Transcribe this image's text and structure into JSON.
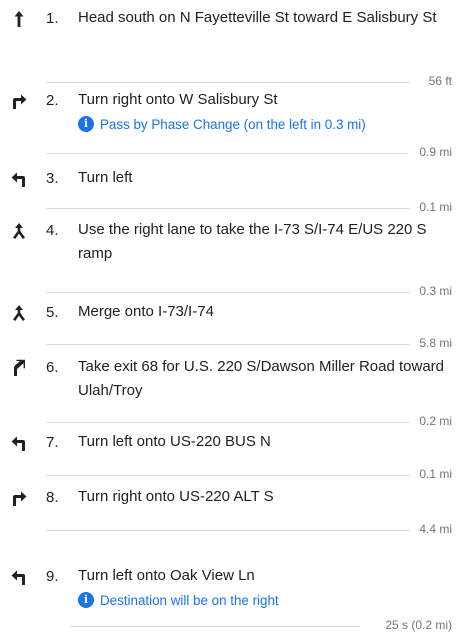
{
  "steps": [
    {
      "num": "1.",
      "icon": "straight-arrow-icon",
      "text": "Head south on N Fayetteville St toward E Salisbury St",
      "note": "",
      "distance": "56 ft"
    },
    {
      "num": "2.",
      "icon": "turn-right-icon",
      "text": "Turn right onto W Salisbury St",
      "note": "Pass by Phase Change (on the left in 0.3 mi)",
      "distance": "0.9 mi"
    },
    {
      "num": "3.",
      "icon": "turn-left-icon",
      "text": "Turn left",
      "note": "",
      "distance": "0.1 mi"
    },
    {
      "num": "4.",
      "icon": "merge-icon",
      "text": "Use the right lane to take the I-73 S/I-74 E/US 220 S ramp",
      "note": "",
      "distance": "0.3 mi"
    },
    {
      "num": "5.",
      "icon": "merge-icon",
      "text": "Merge onto I-73/I-74",
      "note": "",
      "distance": "5.8 mi"
    },
    {
      "num": "6.",
      "icon": "slight-right-icon",
      "text": "Take exit 68 for U.S. 220 S/Dawson Miller Road toward Ulah/Troy",
      "note": "",
      "distance": "0.2 mi"
    },
    {
      "num": "7.",
      "icon": "turn-left-icon",
      "text": "Turn left onto US-220 BUS N",
      "note": "",
      "distance": "0.1 mi"
    },
    {
      "num": "8.",
      "icon": "turn-right-icon",
      "text": "Turn right onto US-220 ALT S",
      "note": "",
      "distance": "4.4 mi"
    },
    {
      "num": "9.",
      "icon": "turn-left-icon",
      "text": "Turn left onto Oak View Ln",
      "note": "Destination will be on the right",
      "distance": "25 s (0.2 mi)"
    }
  ],
  "info_glyph": "i",
  "colors": {
    "text": "#202124",
    "secondary": "#70757a",
    "accent": "#1a73e8",
    "divider": "#dadce0"
  }
}
